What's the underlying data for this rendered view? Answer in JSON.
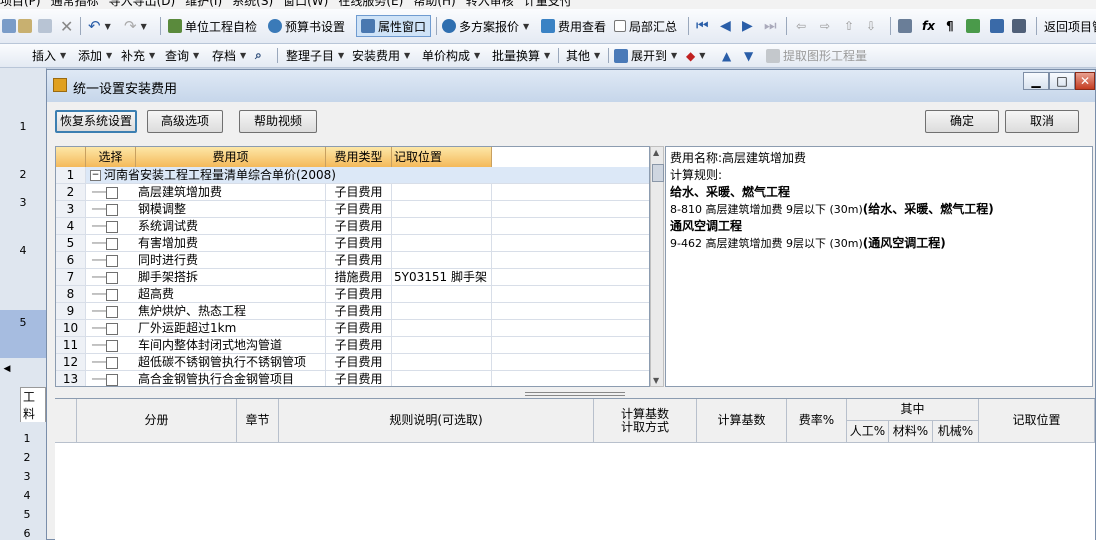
{
  "menubar": {
    "items": [
      "项目(P)",
      "通常指标",
      "导入导出(D)",
      "维护(I)",
      "系统(S)",
      "窗口(W)",
      "在线服务(E)",
      "帮助(H)",
      "转入审核",
      "计量支付"
    ]
  },
  "toolbar1": {
    "unit_check": "单位工程自检",
    "budget_settings": "预算书设置",
    "property_window": "属性窗口",
    "multi_quote": "多方案报价",
    "fee_view": "费用查看",
    "partial_summary": "局部汇总",
    "back_project": "返回项目管"
  },
  "toolbar2": {
    "insert": "插入",
    "add": "添加",
    "supplement": "补充",
    "query": "查询",
    "archive": "存档",
    "arrange": "整理子目",
    "install_fee": "安装费用",
    "unit_price": "单价构成",
    "batch_convert": "批量换算",
    "other": "其他",
    "expand": "展开到",
    "extract": "提取图形工程量"
  },
  "bg_rows": [
    "1",
    "2",
    "3",
    "4",
    "5"
  ],
  "bg_bottom_rows": [
    "1",
    "2",
    "3",
    "4",
    "5",
    "6"
  ],
  "bg_tab_label": "工料",
  "dialog": {
    "title": "统一设置安装费用",
    "window_controls": {
      "minimize": "▁",
      "maximize": "□",
      "close": "✕"
    },
    "buttons": {
      "restore": "恢复系统设置",
      "advanced": "高级选项",
      "help_video": "帮助视频",
      "ok": "确定",
      "cancel": "取消"
    },
    "grid": {
      "headers": [
        "",
        "选择",
        "费用项",
        "费用类型",
        "记取位置"
      ],
      "root": {
        "num": "1",
        "name": "河南省安装工程工程量清单综合单价(2008)"
      },
      "rows": [
        {
          "num": "2",
          "name": "高层建筑增加费",
          "type": "子目费用",
          "pos": ""
        },
        {
          "num": "3",
          "name": "钢模调整",
          "type": "子目费用",
          "pos": ""
        },
        {
          "num": "4",
          "name": "系统调试费",
          "type": "子目费用",
          "pos": ""
        },
        {
          "num": "5",
          "name": "有害增加费",
          "type": "子目费用",
          "pos": ""
        },
        {
          "num": "6",
          "name": "同时进行费",
          "type": "子目费用",
          "pos": ""
        },
        {
          "num": "7",
          "name": "脚手架搭拆",
          "type": "措施费用",
          "pos": "5Y03151  脚手架"
        },
        {
          "num": "8",
          "name": "超高费",
          "type": "子目费用",
          "pos": ""
        },
        {
          "num": "9",
          "name": "焦炉烘炉、热态工程",
          "type": "子目费用",
          "pos": ""
        },
        {
          "num": "10",
          "name": "厂外运距超过1km",
          "type": "子目费用",
          "pos": ""
        },
        {
          "num": "11",
          "name": "车间内整体封闭式地沟管道",
          "type": "子目费用",
          "pos": ""
        },
        {
          "num": "12",
          "name": "超低碳不锈钢管执行不锈钢管项",
          "type": "子目费用",
          "pos": ""
        },
        {
          "num": "13",
          "name": "高合金钢管执行合金钢管项目",
          "type": "子目费用",
          "pos": ""
        }
      ]
    },
    "info": {
      "fee_name": "费用名称:高层建筑增加费",
      "calc_rule": "计算规则:",
      "section1_title": "给水、采暖、燃气工程",
      "section1_line_a": "8-810 高层建筑增加费 9层以下 (30m)",
      "section1_line_b": "(给水、采暖、燃气工程)",
      "section2_title": "通风空调工程",
      "section2_line_a": "9-462 高层建筑增加费 9层以下 (30m)",
      "section2_line_b": "(通风空调工程)"
    },
    "bottom_table": {
      "headers": {
        "division": "分册",
        "chapter": "章节",
        "rule_desc": "规则说明(可选取)",
        "calc_base_method_l1": "计算基数",
        "calc_base_method_l2": "计取方式",
        "calc_base": "计算基数",
        "rate": "费率%",
        "among": "其中",
        "labor": "人工%",
        "material": "材料%",
        "machine": "机械%",
        "position": "记取位置"
      }
    }
  }
}
